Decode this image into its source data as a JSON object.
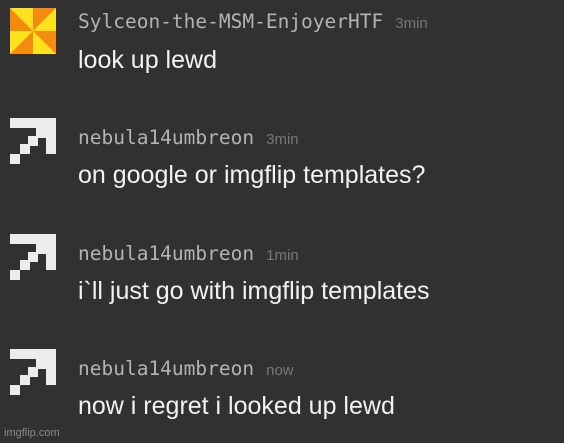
{
  "messages": [
    {
      "username": "Sylceon-the-MSM-EnjoyerHTF",
      "time": "3min",
      "text": "look up lewd",
      "avatar": "pinwheel-avatar-icon"
    },
    {
      "username": "nebula14umbreon",
      "time": "3min",
      "text": "on google or imgflip templates?",
      "avatar": "pixel-arrow-avatar-icon"
    },
    {
      "username": "nebula14umbreon",
      "time": "1min",
      "text": "i`ll just go with imgflip templates",
      "avatar": "pixel-arrow-avatar-icon"
    },
    {
      "username": "nebula14umbreon",
      "time": "now",
      "text": "now i regret i looked up lewd",
      "avatar": "pixel-arrow-avatar-icon"
    }
  ],
  "colors": {
    "background": "#313131",
    "username": "#b3b3b3",
    "time": "#777777",
    "text": "#f2f2f2",
    "pinwheel_orange": "#f48a10",
    "pinwheel_yellow": "#fde21c"
  },
  "watermark": "imgflip.com"
}
